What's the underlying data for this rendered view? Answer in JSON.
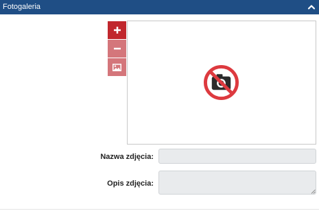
{
  "panel": {
    "title": "Fotogaleria",
    "collapse_icon": "chevron-up-icon"
  },
  "toolbar": {
    "add_icon": "plus-icon",
    "remove_icon": "minus-icon",
    "image_icon": "image-icon"
  },
  "photo_placeholder": {
    "icon": "no-photo-icon"
  },
  "form": {
    "name_label": "Nazwa zdjęcia:",
    "name_value": "",
    "description_label": "Opis zdjęcia:",
    "description_value": ""
  },
  "colors": {
    "header_bg": "#1f4e85",
    "button_active": "#c1272d",
    "button_disabled": "#d4767b",
    "no_photo_red": "#dd3a3f",
    "field_bg": "#e9ebed"
  }
}
